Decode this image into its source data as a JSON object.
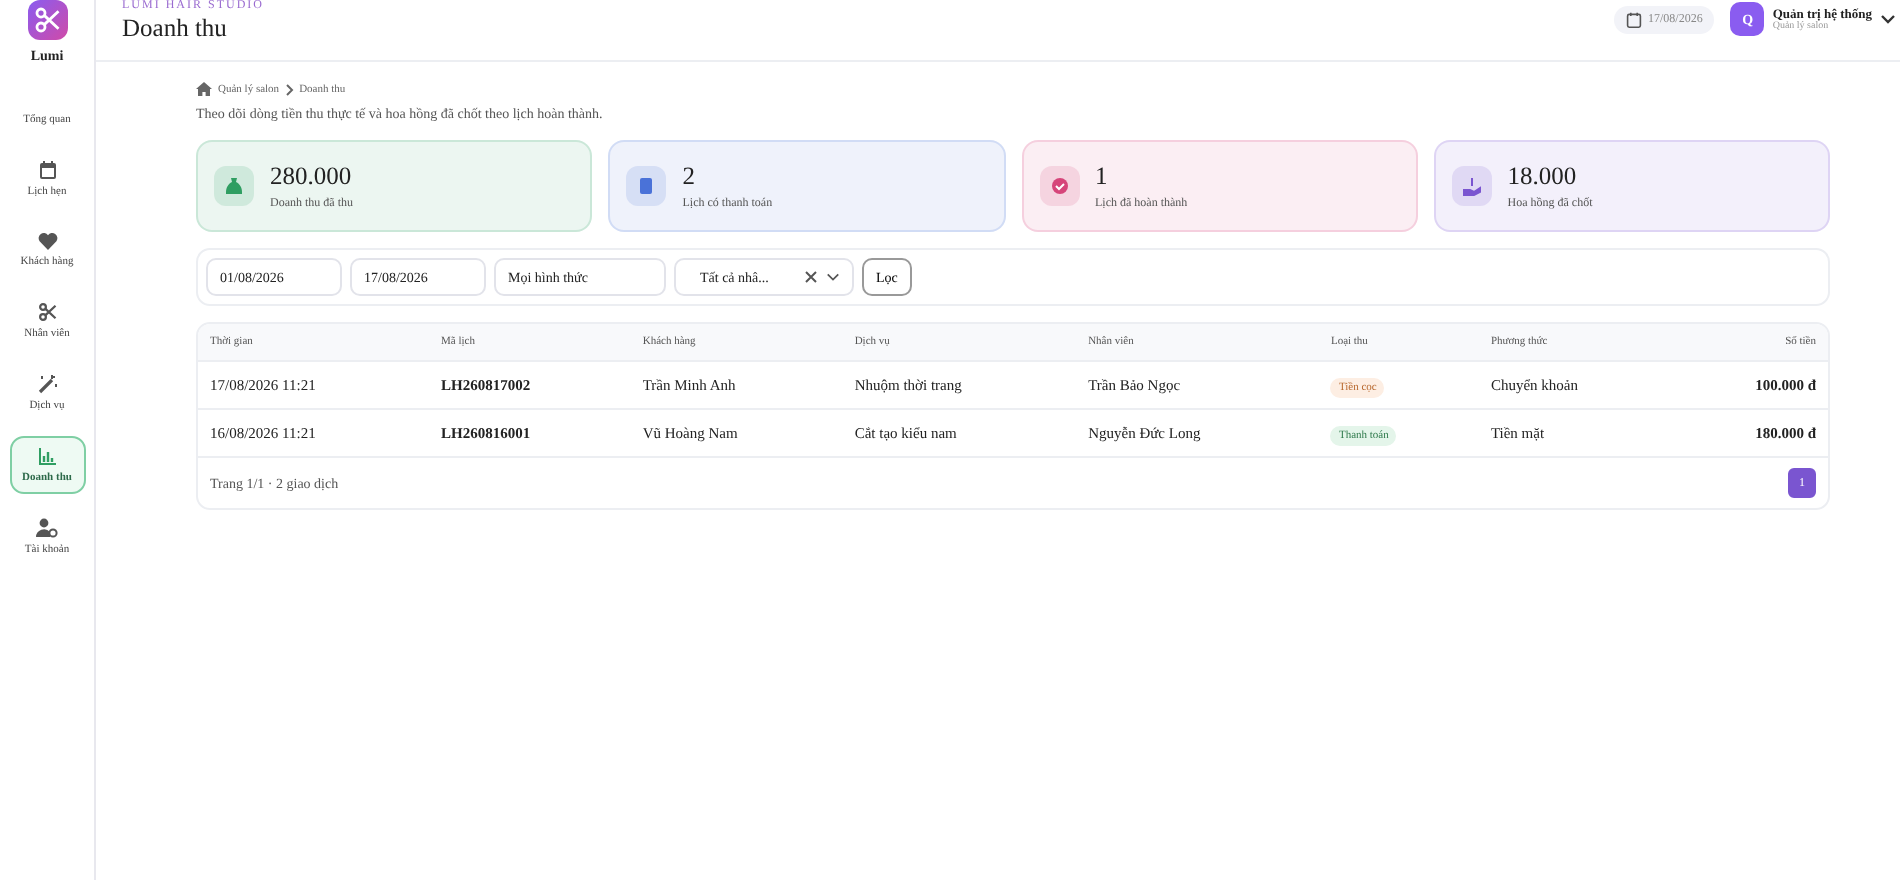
{
  "brand": {
    "name": "Lumi"
  },
  "sidebar": {
    "items": [
      {
        "label": "Tổng quan",
        "selected": false
      },
      {
        "label": "Lịch hẹn",
        "selected": false
      },
      {
        "label": "Khách hàng",
        "selected": false
      },
      {
        "label": "Nhân viên",
        "selected": false
      },
      {
        "label": "Dịch vụ",
        "selected": false
      },
      {
        "label": "Doanh thu",
        "selected": true
      },
      {
        "label": "Tài khoản",
        "selected": false
      }
    ]
  },
  "header": {
    "studio": "LUMI HAIR STUDIO",
    "title": "Doanh thu",
    "date": "17/08/2026",
    "user": {
      "initial": "Q",
      "name": "Quản trị hệ thống",
      "role": "Quản lý salon"
    }
  },
  "breadcrumb": [
    "Quản lý salon",
    "Doanh thu"
  ],
  "description": "Theo dõi dòng tiền thu thực tế và hoa hồng đã chốt theo lịch hoàn thành.",
  "stats": [
    {
      "value": "280.000",
      "label": "Doanh thu đã thu",
      "color": "#2f9e62"
    },
    {
      "value": "2",
      "label": "Lịch có thanh toán",
      "color": "#4a72d8"
    },
    {
      "value": "1",
      "label": "Lịch đã hoàn thành",
      "color": "#d6457a"
    },
    {
      "value": "18.000",
      "label": "Hoa hồng đã chốt",
      "color": "#7a55d0"
    }
  ],
  "filters": {
    "from": "01/08/2026",
    "to": "17/08/2026",
    "method": "Mọi hình thức",
    "staff": "Tất cả nhâ...",
    "button": "Lọc"
  },
  "table": {
    "columns": [
      "Thời gian",
      "Mã lịch",
      "Khách hàng",
      "Dịch vụ",
      "Nhân viên",
      "Loại thu",
      "Phương thức",
      "Số tiền"
    ],
    "rows": [
      {
        "time": "17/08/2026 11:21",
        "code": "LH260817002",
        "customer": "Trần Minh Anh",
        "service": "Nhuộm thời trang",
        "staff": "Trần Bảo Ngọc",
        "type": {
          "label": "Tiền cọc",
          "kind": "deposit"
        },
        "method": "Chuyển khoản",
        "amount": "100.000 đ"
      },
      {
        "time": "16/08/2026 11:21",
        "code": "LH260816001",
        "customer": "Vũ Hoàng Nam",
        "service": "Cắt tạo kiểu nam",
        "staff": "Nguyễn Đức Long",
        "type": {
          "label": "Thanh toán",
          "kind": "payment"
        },
        "method": "Tiền mặt",
        "amount": "180.000 đ"
      }
    ]
  },
  "pagination": {
    "summary": "Trang 1/1 · 2 giao dịch",
    "pages": [
      {
        "label": "1",
        "selected": true
      }
    ]
  }
}
